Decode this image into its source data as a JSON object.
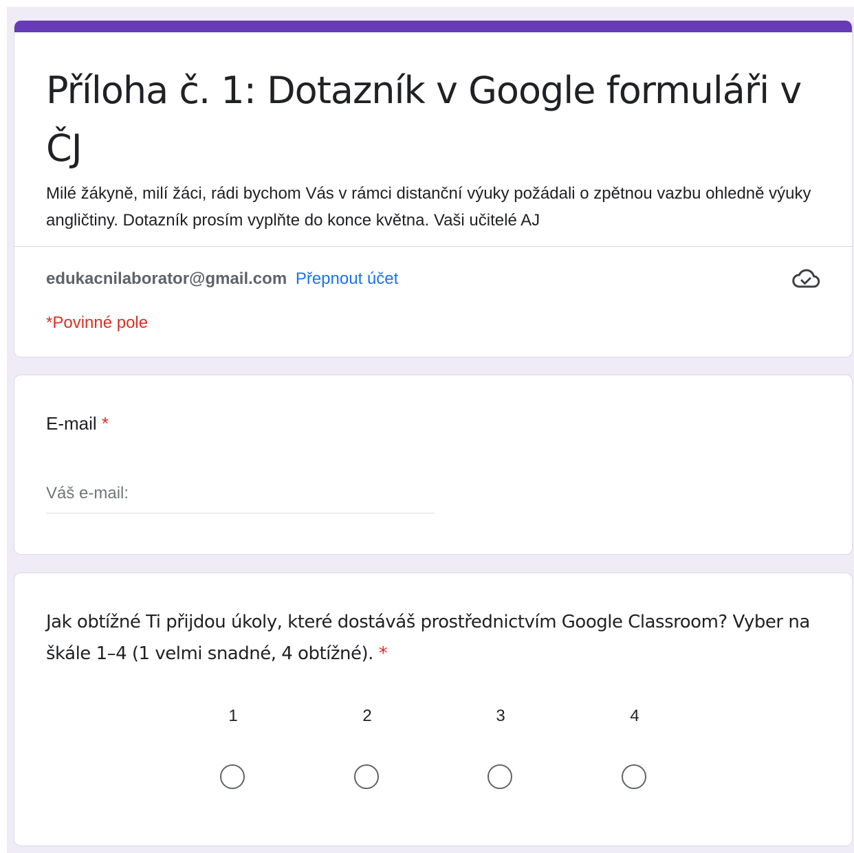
{
  "form": {
    "accent_color": "#673ab7",
    "title": "Příloha č. 1: Dotazník v Google formuláři v ČJ",
    "description": "Milé žákyně, milí žáci, rádi bychom Vás v rámci distanční výuky požádali o zpětnou vazbu ohledně výuky angličtiny. Dotazník prosím vyplňte do konce května.  Vaši učitelé AJ",
    "account_email": "edukacnilaborator@gmail.com",
    "switch_account_label": "Přepnout účet",
    "save_status_icon": "cloud-check-icon",
    "required_note": "*Povinné pole"
  },
  "questions": {
    "email": {
      "label": "E-mail",
      "required_mark": "*",
      "placeholder": "Váš e-mail:",
      "value": ""
    },
    "difficulty": {
      "label": "Jak obtížné Ti přijdou úkoly, které dostáváš prostřednictvím Google Classroom? Vyber na škále 1–4 (1 velmi snadné, 4 obtížné).",
      "required_mark": "*",
      "options": [
        "1",
        "2",
        "3",
        "4"
      ],
      "selected": null
    }
  }
}
